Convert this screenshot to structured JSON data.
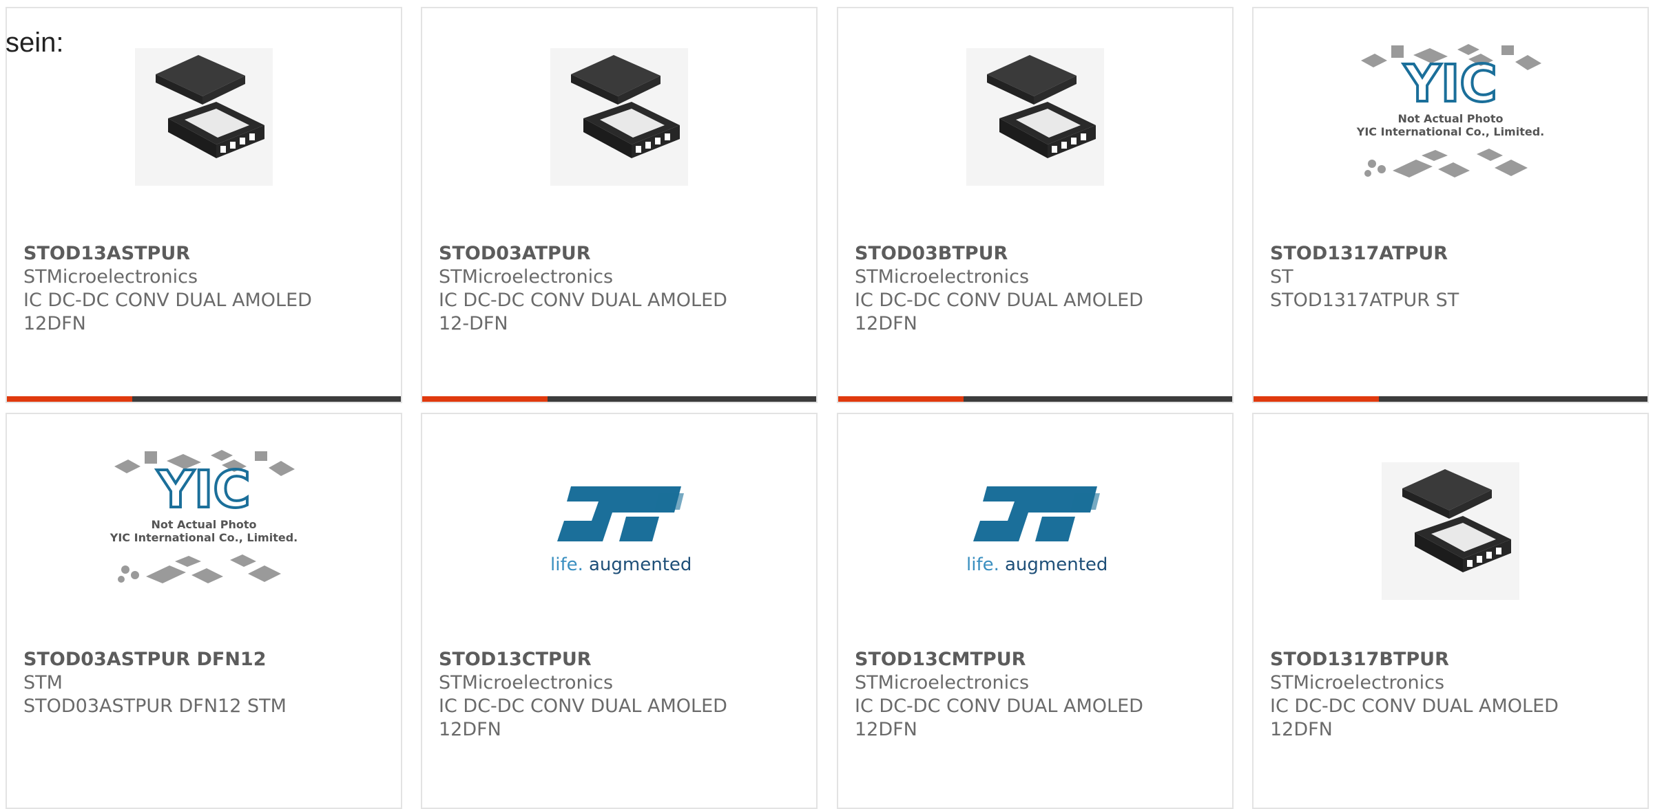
{
  "intro_text": "sein:",
  "colors": {
    "accent_bar": "#e03a0e",
    "dark_bar": "#3c3c3c",
    "st_blue": "#1b6f9a"
  },
  "products": [
    {
      "part": "STOD13ASTPUR",
      "maker": "STMicroelectronics",
      "desc1": "IC DC-DC CONV DUAL AMOLED",
      "desc2": "12DFN",
      "image": "chip-photo"
    },
    {
      "part": "STOD03ATPUR",
      "maker": "STMicroelectronics",
      "desc1": "IC DC-DC CONV DUAL AMOLED",
      "desc2": "12-DFN",
      "image": "chip-photo"
    },
    {
      "part": "STOD03BTPUR",
      "maker": "STMicroelectronics",
      "desc1": "IC DC-DC CONV DUAL AMOLED",
      "desc2": "12DFN",
      "image": "chip-photo"
    },
    {
      "part": "STOD1317ATPUR",
      "maker": "ST",
      "desc1": "STOD1317ATPUR ST",
      "desc2": "",
      "image": "yic-placeholder"
    },
    {
      "part": "STOD03ASTPUR DFN12",
      "maker": "STM",
      "desc1": "STOD03ASTPUR DFN12 STM",
      "desc2": "",
      "image": "yic-placeholder"
    },
    {
      "part": "STOD13CTPUR",
      "maker": "STMicroelectronics",
      "desc1": "IC DC-DC CONV DUAL AMOLED",
      "desc2": "12DFN",
      "image": "st-logo"
    },
    {
      "part": "STOD13CMTPUR",
      "maker": "STMicroelectronics",
      "desc1": "IC DC-DC CONV DUAL AMOLED",
      "desc2": "12DFN",
      "image": "st-logo"
    },
    {
      "part": "STOD1317BTPUR",
      "maker": "STMicroelectronics",
      "desc1": "IC DC-DC CONV DUAL AMOLED",
      "desc2": "12DFN",
      "image": "chip-photo"
    }
  ],
  "yic_placeholder": {
    "brand": "YIC",
    "line1": "Not Actual Photo",
    "line2": "YIC International Co., Limited."
  },
  "st_logo": {
    "tagline_left": "life.",
    "tagline_right": "augmented"
  }
}
